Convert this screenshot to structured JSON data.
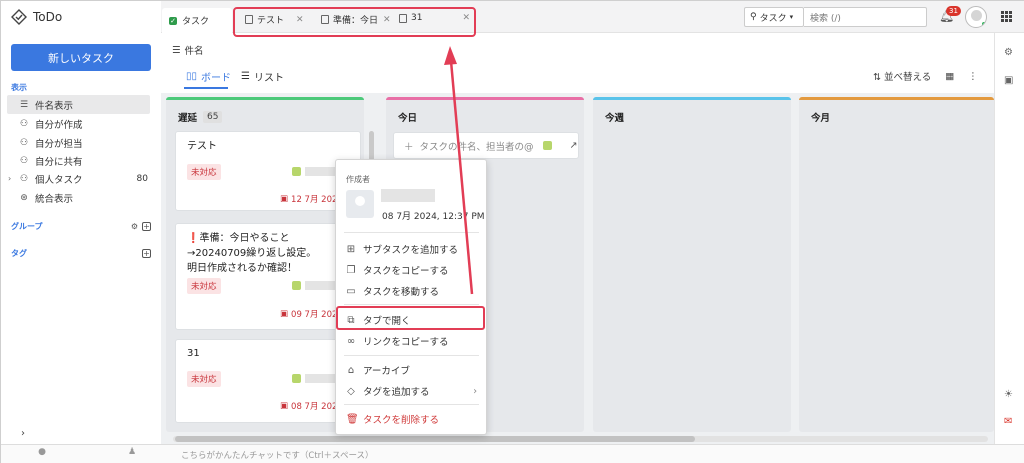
{
  "app": {
    "name": "ToDo"
  },
  "sidebar": {
    "new_task_label": "新しいタスク",
    "display_section": "表示",
    "items": [
      {
        "label": "件名表示",
        "icon": "list-icon"
      },
      {
        "label": "自分が作成",
        "icon": "user-plus-icon"
      },
      {
        "label": "自分が担当",
        "icon": "user-check-icon"
      },
      {
        "label": "自分に共有",
        "icon": "user-share-icon"
      },
      {
        "label": "個人タスク",
        "icon": "user-icon",
        "count": "80"
      },
      {
        "label": "統合表示",
        "icon": "merge-icon"
      }
    ],
    "group_label": "グループ",
    "tag_label": "タグ"
  },
  "header": {
    "main_tab": "タスク",
    "tabs": [
      {
        "label": "テスト"
      },
      {
        "label": "準備：今日"
      },
      {
        "label": "31"
      }
    ],
    "search_type": "タスク",
    "search_placeholder": "検索 (/)",
    "notification_count": "31"
  },
  "page": {
    "title": "件名",
    "view_tabs": [
      "ボード",
      "リスト"
    ],
    "sort_label": "並べ替える"
  },
  "columns": [
    {
      "title": "遅延",
      "count": "65",
      "color": "#4cc97a"
    },
    {
      "title": "今日",
      "color": "#e86fa6"
    },
    {
      "title": "今週",
      "color": "#59c3ea"
    },
    {
      "title": "今月",
      "color": "#e39a3f"
    }
  ],
  "cards": [
    {
      "title_lines": [
        "テスト"
      ],
      "status": "未対応",
      "due": "12 7月 2024"
    },
    {
      "title_lines": [
        "❗準備：今日やること",
        "→20240709繰り返し設定。",
        "明日作成されるか確認！"
      ],
      "status": "未対応",
      "due": "09 7月 2024"
    },
    {
      "title_lines": [
        "31"
      ],
      "status": "未対応",
      "due": "08 7月 2024"
    }
  ],
  "add_task_placeholder": "タスクの件名、担当者の@",
  "context_menu": {
    "creator_label": "作成者",
    "created_at": "08 7月 2024, 12:37 PM",
    "items": [
      {
        "label": "サブタスクを追加する",
        "icon": "subtask-icon"
      },
      {
        "label": "タスクをコピーする",
        "icon": "copy-icon"
      },
      {
        "label": "タスクを移動する",
        "icon": "folder-icon"
      },
      {
        "label": "タブで開く",
        "icon": "open-tab-icon"
      },
      {
        "label": "リンクをコピーする",
        "icon": "link-icon"
      },
      {
        "label": "アーカイブ",
        "icon": "archive-icon"
      },
      {
        "label": "タグを追加する",
        "icon": "tag-icon"
      },
      {
        "label": "タスクを削除する",
        "icon": "trash-icon"
      }
    ]
  },
  "bottom": {
    "chat_placeholder": "こちらがかんたんチャットです（Ctrl＋スペース）"
  },
  "accent_color": "#3a78e0",
  "annotation_color": "#e23d55"
}
